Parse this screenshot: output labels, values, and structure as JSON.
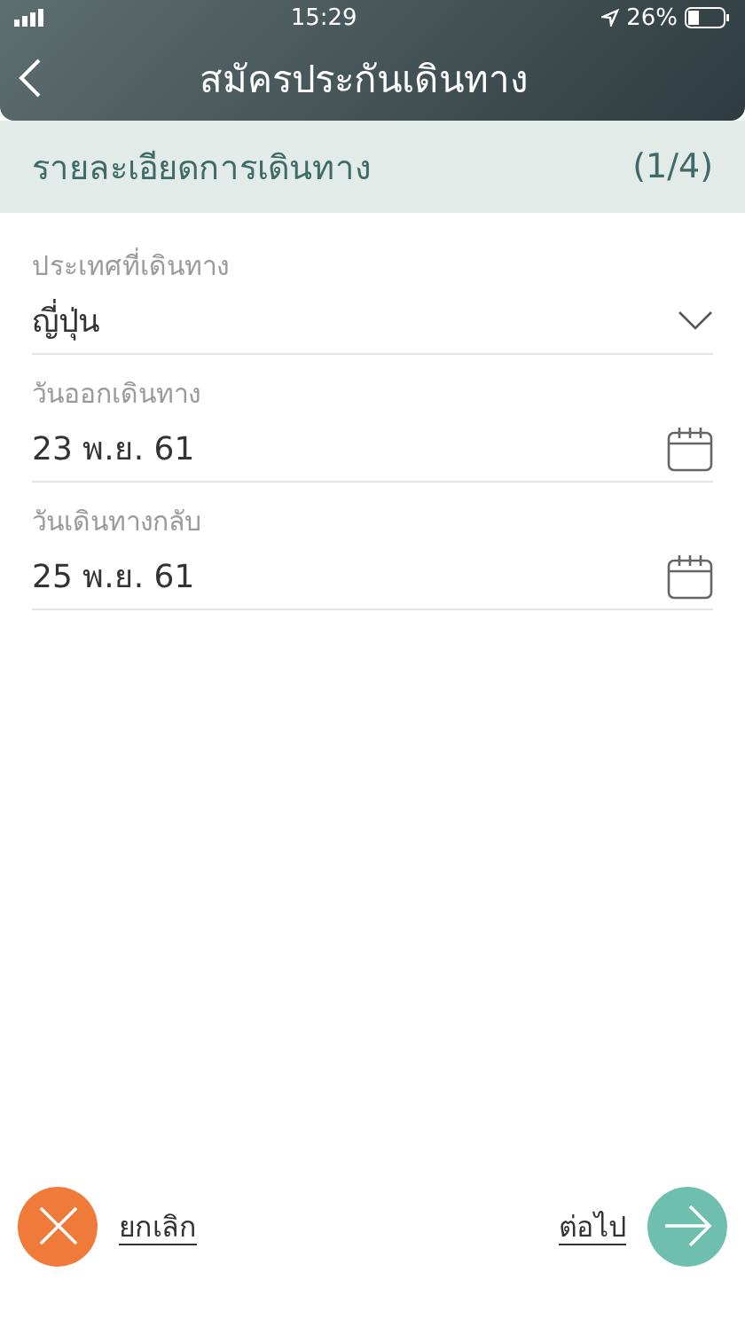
{
  "status_bar": {
    "time": "15:29",
    "battery": "26%"
  },
  "nav": {
    "title": "สมัครประกันเดินทาง"
  },
  "section": {
    "title": "รายละเอียดการเดินทาง",
    "step": "(1/4)"
  },
  "fields": [
    {
      "kind": "select",
      "label": "ประเทศที่เดินทาง",
      "value": "ญี่ปุ่น"
    },
    {
      "kind": "date",
      "label": "วันออกเดินทาง",
      "value": "23 พ.ย. 61"
    },
    {
      "kind": "date",
      "label": "วันเดินทางกลับ",
      "value": "25 พ.ย. 61"
    }
  ],
  "footer": {
    "cancel": "ยกเลิก",
    "next": "ต่อไป"
  }
}
